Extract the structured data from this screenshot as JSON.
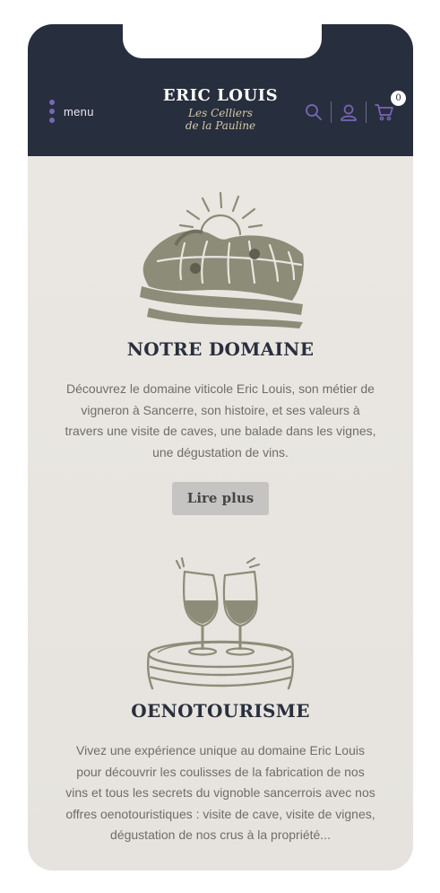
{
  "header": {
    "menu_label": "menu",
    "logo_main": "ERIC LOUIS",
    "logo_sub_line1": "Les Celliers",
    "logo_sub_line2": "de la Pauline",
    "cart_count": "0",
    "icons": [
      "search-icon",
      "account-icon",
      "cart-icon"
    ],
    "colors": {
      "header_bg": "#272e3d",
      "accent": "#7a66b8",
      "logo_sub": "#d7c9a6"
    }
  },
  "sections": [
    {
      "title": "NOTRE DOMAINE",
      "description": "Découvrez le domaine viticole Eric Louis, son métier de vigneron à Sancerre, son histoire, et ses valeurs à travers une visite de caves, une balade dans les vignes, une dégustation de vins.",
      "button_label": "Lire plus",
      "illustration": "vineyard-hills-sunrise"
    },
    {
      "title": "OENOTOURISME",
      "description": "Vivez une expérience unique au domaine Eric Louis pour découvrir les coulisses de la fabrication de nos vins et tous les secrets du vignoble sancerrois avec nos offres oenotouristiques : visite de cave, visite de vignes, dégustation de nos crus à la propriété...",
      "illustration": "wine-glasses-on-barrel"
    }
  ]
}
